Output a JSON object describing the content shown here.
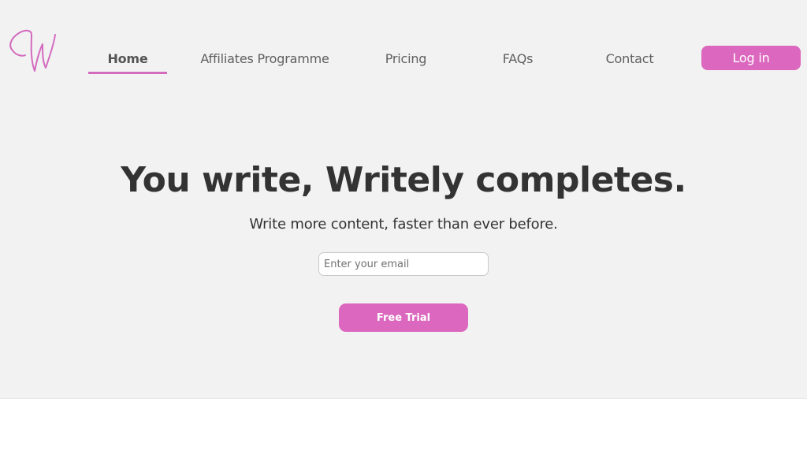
{
  "brand": {
    "logo_icon": "script-w-logo-icon",
    "accent_color": "#db68be"
  },
  "nav": {
    "items": [
      {
        "label": "Home",
        "active": true
      },
      {
        "label": "Affiliates Programme",
        "active": false
      },
      {
        "label": "Pricing",
        "active": false
      },
      {
        "label": "FAQs",
        "active": false
      },
      {
        "label": "Contact",
        "active": false
      }
    ],
    "login_label": "Log in"
  },
  "hero": {
    "headline": "You write, Writely completes.",
    "subline": "Write more content, faster than ever before.",
    "email_placeholder": "Enter your email",
    "email_value": "",
    "cta_label": "Free Trial"
  }
}
